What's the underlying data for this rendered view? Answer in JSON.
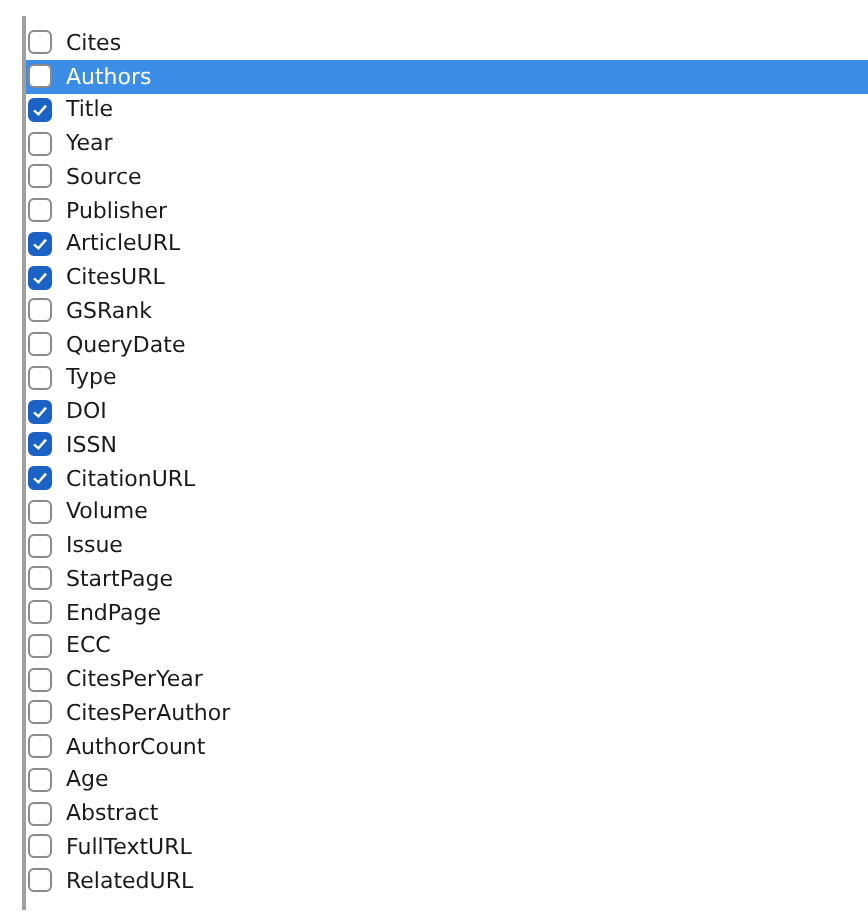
{
  "fields": [
    {
      "label": "Cites",
      "checked": false,
      "selected": false
    },
    {
      "label": "Authors",
      "checked": false,
      "selected": true
    },
    {
      "label": "Title",
      "checked": true,
      "selected": false
    },
    {
      "label": "Year",
      "checked": false,
      "selected": false
    },
    {
      "label": "Source",
      "checked": false,
      "selected": false
    },
    {
      "label": "Publisher",
      "checked": false,
      "selected": false
    },
    {
      "label": "ArticleURL",
      "checked": true,
      "selected": false
    },
    {
      "label": "CitesURL",
      "checked": true,
      "selected": false
    },
    {
      "label": "GSRank",
      "checked": false,
      "selected": false
    },
    {
      "label": "QueryDate",
      "checked": false,
      "selected": false
    },
    {
      "label": "Type",
      "checked": false,
      "selected": false
    },
    {
      "label": "DOI",
      "checked": true,
      "selected": false
    },
    {
      "label": "ISSN",
      "checked": true,
      "selected": false
    },
    {
      "label": "CitationURL",
      "checked": true,
      "selected": false
    },
    {
      "label": "Volume",
      "checked": false,
      "selected": false
    },
    {
      "label": "Issue",
      "checked": false,
      "selected": false
    },
    {
      "label": "StartPage",
      "checked": false,
      "selected": false
    },
    {
      "label": "EndPage",
      "checked": false,
      "selected": false
    },
    {
      "label": "ECC",
      "checked": false,
      "selected": false
    },
    {
      "label": "CitesPerYear",
      "checked": false,
      "selected": false
    },
    {
      "label": "CitesPerAuthor",
      "checked": false,
      "selected": false
    },
    {
      "label": "AuthorCount",
      "checked": false,
      "selected": false
    },
    {
      "label": "Age",
      "checked": false,
      "selected": false
    },
    {
      "label": "Abstract",
      "checked": false,
      "selected": false
    },
    {
      "label": "FullTextURL",
      "checked": false,
      "selected": false
    },
    {
      "label": "RelatedURL",
      "checked": false,
      "selected": false
    }
  ]
}
